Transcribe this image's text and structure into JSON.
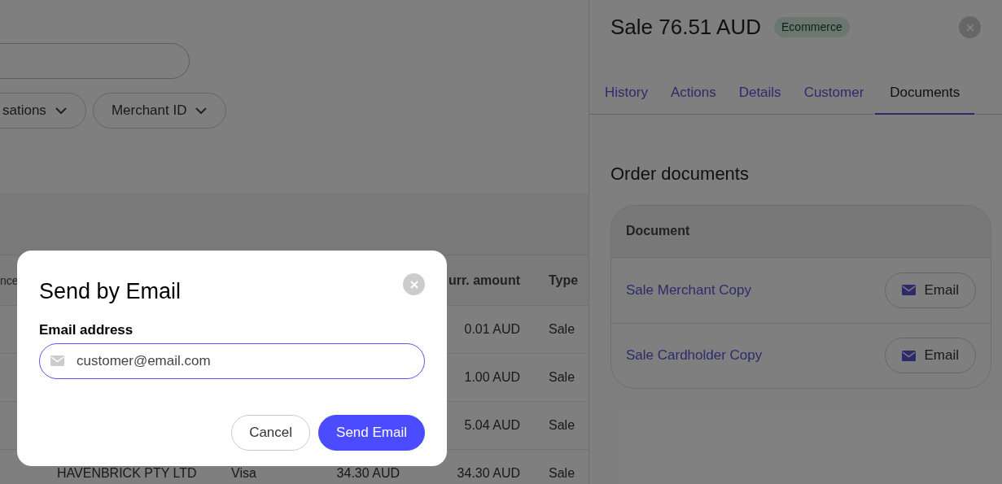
{
  "filters": [
    {
      "label": "sations"
    },
    {
      "label": "Merchant ID"
    }
  ],
  "table": {
    "header": {
      "column_1": "nce",
      "column_5": "urr. amount",
      "column_6": "Type"
    },
    "rows": [
      {
        "column_5": "0.01 AUD",
        "column_6": "Sale"
      },
      {
        "column_5": "1.00 AUD",
        "column_6": "Sale"
      },
      {
        "column_5": "5.04 AUD",
        "column_6": "Sale"
      },
      {
        "column_2": "HAVENBRICK PTY LTD",
        "column_3": "Visa",
        "column_4": "34.30 AUD",
        "column_5": "34.30 AUD",
        "column_6": "Sale"
      }
    ]
  },
  "panel": {
    "title": "Sale 76.51 AUD",
    "badge": "Ecommerce",
    "tabs": [
      {
        "label": "History",
        "selected": false
      },
      {
        "label": "Actions",
        "selected": false
      },
      {
        "label": "Details",
        "selected": false
      },
      {
        "label": "Customer",
        "selected": false
      },
      {
        "label": "Documents",
        "selected": true
      }
    ],
    "section_title": "Order documents",
    "documents_header": "Document",
    "documents": [
      {
        "name": "Sale Merchant Copy",
        "action": "Email"
      },
      {
        "name": "Sale Cardholder Copy",
        "action": "Email"
      }
    ]
  },
  "dialog": {
    "title": "Send by Email",
    "field_label": "Email address",
    "value": "customer@email.com",
    "buttons": [
      {
        "kind": "secondary",
        "label": "Cancel"
      },
      {
        "kind": "primary",
        "label": "Send Email"
      }
    ]
  }
}
